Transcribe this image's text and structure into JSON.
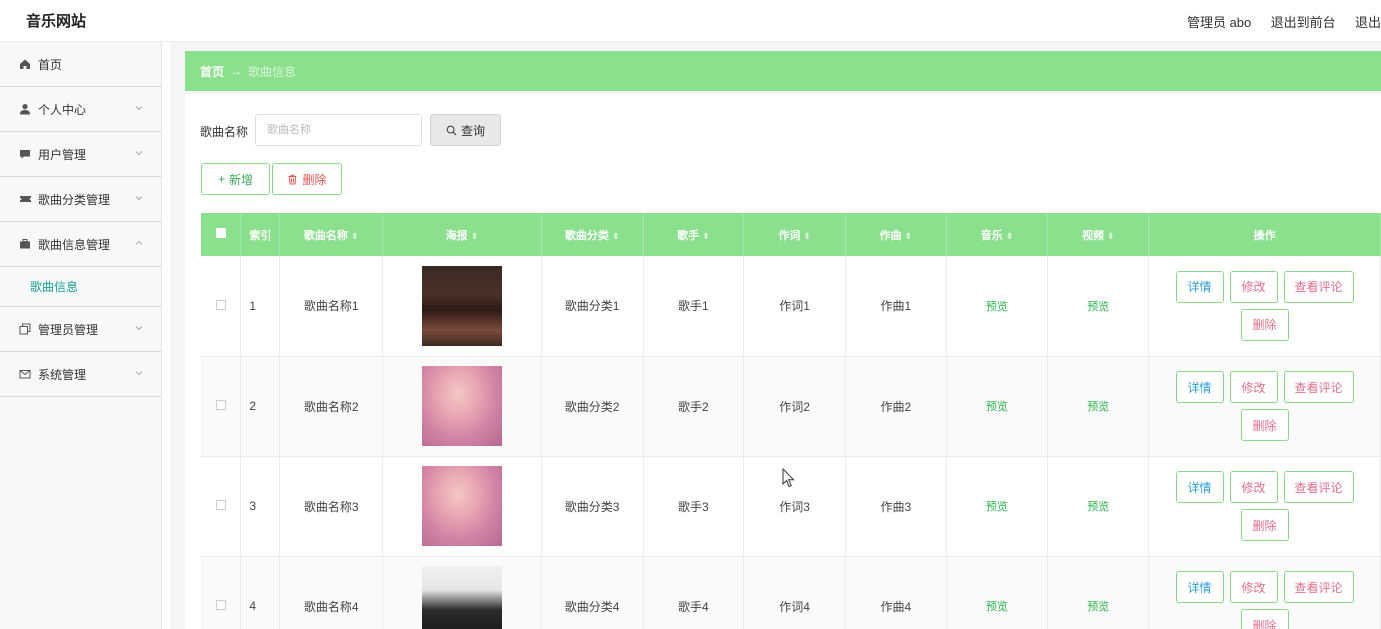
{
  "header": {
    "brand": "音乐网站",
    "nav": [
      "管理员 abo",
      "退出到前台",
      "退出"
    ]
  },
  "sidebar": {
    "items": [
      {
        "label": "首页",
        "icon": "home-icon"
      },
      {
        "label": "个人中心",
        "icon": "user-icon"
      },
      {
        "label": "用户管理",
        "icon": "chat-icon"
      },
      {
        "label": "歌曲分类管理",
        "icon": "ticket-icon"
      },
      {
        "label": "歌曲信息管理",
        "icon": "briefcase-icon"
      },
      {
        "label": "管理员管理",
        "icon": "copy-icon"
      },
      {
        "label": "系统管理",
        "icon": "mail-icon"
      }
    ],
    "active_sub": "歌曲信息"
  },
  "breadcrumb": {
    "home": "首页",
    "arrow": "→",
    "current": "歌曲信息"
  },
  "search": {
    "label": "歌曲名称",
    "placeholder": "歌曲名称",
    "button": "查询"
  },
  "actions": {
    "add": "新增",
    "add_icon": "+",
    "delete": "删除"
  },
  "table": {
    "columns": [
      "索引",
      "歌曲名称",
      "海报",
      "歌曲分类",
      "歌手",
      "作词",
      "作曲",
      "音乐",
      "视频",
      "操作"
    ],
    "sort_glyph": "⬍",
    "preview_label": "预览",
    "ops": {
      "detail": "详情",
      "edit": "修改",
      "comments": "查看评论",
      "delete": "删除"
    },
    "rows": [
      {
        "index": "1",
        "name": "歌曲名称1",
        "category": "歌曲分类1",
        "singer": "歌手1",
        "lyricist": "作词1",
        "composer": "作曲1"
      },
      {
        "index": "2",
        "name": "歌曲名称2",
        "category": "歌曲分类2",
        "singer": "歌手2",
        "lyricist": "作词2",
        "composer": "作曲2"
      },
      {
        "index": "3",
        "name": "歌曲名称3",
        "category": "歌曲分类3",
        "singer": "歌手3",
        "lyricist": "作词3",
        "composer": "作曲3"
      },
      {
        "index": "4",
        "name": "歌曲名称4",
        "category": "歌曲分类4",
        "singer": "歌手4",
        "lyricist": "作词4",
        "composer": "作曲4"
      }
    ]
  },
  "colors": {
    "accent_green": "#8ae08c",
    "link_teal": "#1aa094",
    "danger": "#e45454"
  }
}
